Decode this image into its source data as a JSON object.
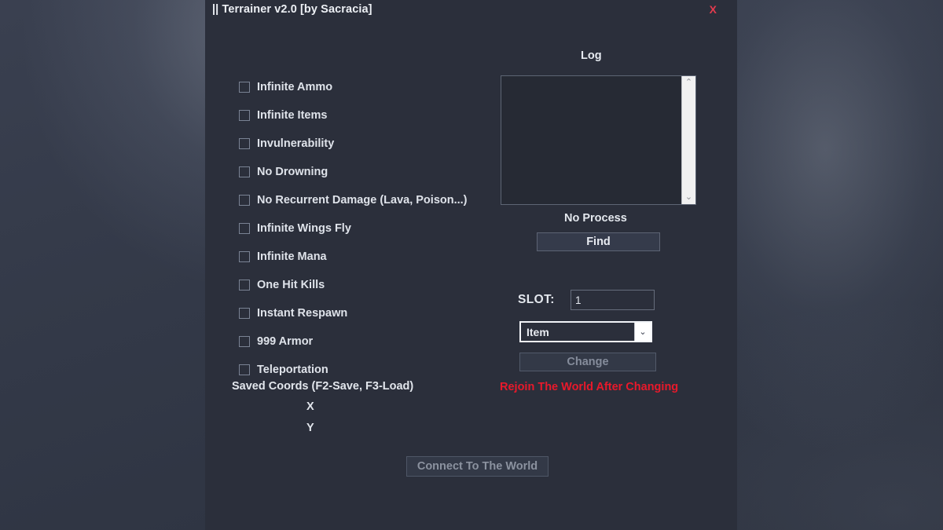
{
  "window": {
    "title": "|| Terrainer v2.0 [by Sacracia]",
    "close_label": "X"
  },
  "options": [
    {
      "label": "Infinite Ammo",
      "checked": false
    },
    {
      "label": "Infinite Items",
      "checked": false
    },
    {
      "label": "Invulnerability",
      "checked": false
    },
    {
      "label": "No Drowning",
      "checked": false
    },
    {
      "label": "No Recurrent Damage (Lava, Poison...)",
      "checked": false
    },
    {
      "label": "Infinite Wings Fly",
      "checked": false
    },
    {
      "label": "Infinite Mana",
      "checked": false
    },
    {
      "label": "One Hit Kills",
      "checked": false
    },
    {
      "label": "Instant Respawn",
      "checked": false
    },
    {
      "label": "999 Armor",
      "checked": false
    },
    {
      "label": "Teleportation",
      "checked": false
    }
  ],
  "saved_coords": {
    "title": "Saved Coords (F2-Save, F3-Load)",
    "x_label": "X",
    "y_label": "Y",
    "x_value": "",
    "y_value": ""
  },
  "log": {
    "title": "Log",
    "content": "",
    "scroll_up_icon": "⌃",
    "scroll_down_icon": "⌄"
  },
  "process": {
    "status": "No Process",
    "find_label": "Find"
  },
  "slot": {
    "label": "SLOT:",
    "value": "1",
    "placeholder": ""
  },
  "mode_select": {
    "selected": "Item",
    "options": [
      "Item"
    ],
    "chevron_icon": "⌄"
  },
  "actions": {
    "change_label": "Change",
    "connect_label": "Connect To The World"
  },
  "warning": {
    "text": "Rejoin The World After Changing"
  },
  "colors": {
    "panel_bg": "#2b2f3b",
    "accent_red": "#e8192b",
    "close_red": "#e33b4e",
    "text_primary": "#e6e9ef",
    "text_disabled": "#8b929f"
  }
}
